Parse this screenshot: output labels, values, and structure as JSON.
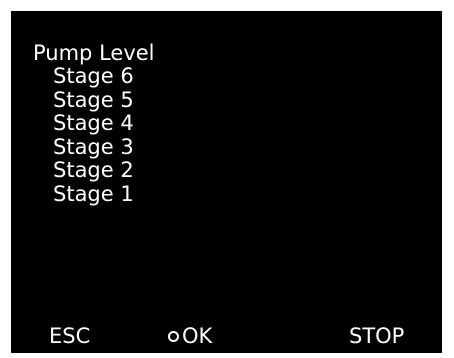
{
  "menu": {
    "title": "Pump Level",
    "items": [
      {
        "label": "Stage 6"
      },
      {
        "label": "Stage 5"
      },
      {
        "label": "Stage 4"
      },
      {
        "label": "Stage 3"
      },
      {
        "label": "Stage 2"
      },
      {
        "label": "Stage 1"
      }
    ]
  },
  "softkeys": {
    "esc_label": "ESC",
    "ok_label": "OK",
    "ok_icon": "ring-icon",
    "stop_label": "STOP"
  },
  "colors": {
    "screen_background": "#000000",
    "text": "#ffffff",
    "bezel": "#ffffff"
  }
}
